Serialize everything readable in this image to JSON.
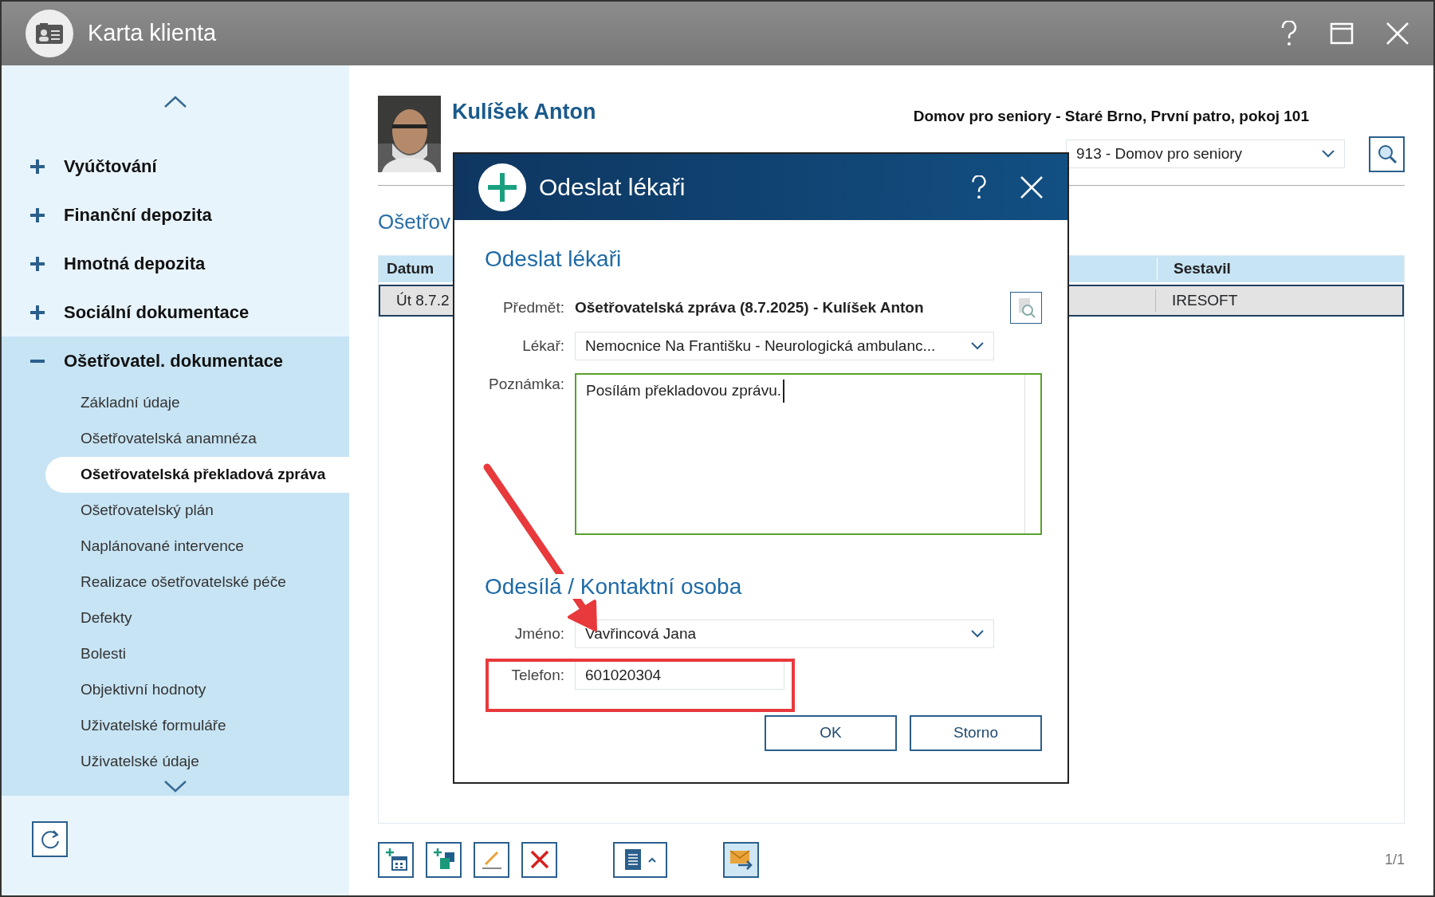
{
  "window": {
    "title": "Karta klienta"
  },
  "sidebar": {
    "items": [
      {
        "label": "Vyúčtování",
        "expanded": false
      },
      {
        "label": "Finanční depozita",
        "expanded": false
      },
      {
        "label": "Hmotná depozita",
        "expanded": false
      },
      {
        "label": "Sociální dokumentace",
        "expanded": false
      },
      {
        "label": "Ošetřovatel. dokumentace",
        "expanded": true,
        "children": [
          {
            "label": "Základní údaje",
            "selected": false
          },
          {
            "label": "Ošetřovatelská anamnéza",
            "selected": false
          },
          {
            "label": "Ošetřovatelská překladová zpráva",
            "selected": true
          },
          {
            "label": "Ošetřovatelský plán",
            "selected": false
          },
          {
            "label": "Naplánované intervence",
            "selected": false
          },
          {
            "label": "Realizace ošetřovatelské péče",
            "selected": false
          },
          {
            "label": "Defekty",
            "selected": false
          },
          {
            "label": "Bolesti",
            "selected": false
          },
          {
            "label": "Objektivní hodnoty",
            "selected": false
          },
          {
            "label": "Uživatelské formuláře",
            "selected": false
          },
          {
            "label": "Uživatelské údaje",
            "selected": false
          }
        ]
      }
    ]
  },
  "client": {
    "name": "Kulíšek Anton",
    "location": "Domov pro seniory - Staré Brno, První patro, pokoj 101",
    "facility": "913 - Domov pro seniory"
  },
  "section_title": "Ošetřov",
  "table": {
    "columns": [
      "Datum",
      "Sestavil"
    ],
    "rows": [
      {
        "cells": [
          "Út 8.7.2",
          "IRESOFT"
        ],
        "selected": true
      }
    ]
  },
  "pager": "1/1",
  "dialog": {
    "title": "Odeslat lékaři",
    "sections": [
      {
        "heading": "Odeslat lékaři",
        "fields": [
          {
            "kind": "static",
            "label": "Předmět:",
            "value": "Ošetřovatelská zpráva (8.7.2025) - Kulíšek Anton"
          },
          {
            "kind": "select",
            "label": "Lékař:",
            "value": "Nemocnice Na Františku - Neurologická ambulanc..."
          },
          {
            "kind": "textarea",
            "label": "Poznámka:",
            "value": "Posílám překladovou zprávu."
          }
        ]
      },
      {
        "heading": "Odesílá / Kontaktní osoba",
        "fields": [
          {
            "kind": "select",
            "label": "Jméno:",
            "value": "Vavřincová Jana"
          },
          {
            "kind": "text",
            "label": "Telefon:",
            "value": "601020304"
          }
        ]
      }
    ],
    "buttons": [
      "OK",
      "Storno"
    ]
  }
}
